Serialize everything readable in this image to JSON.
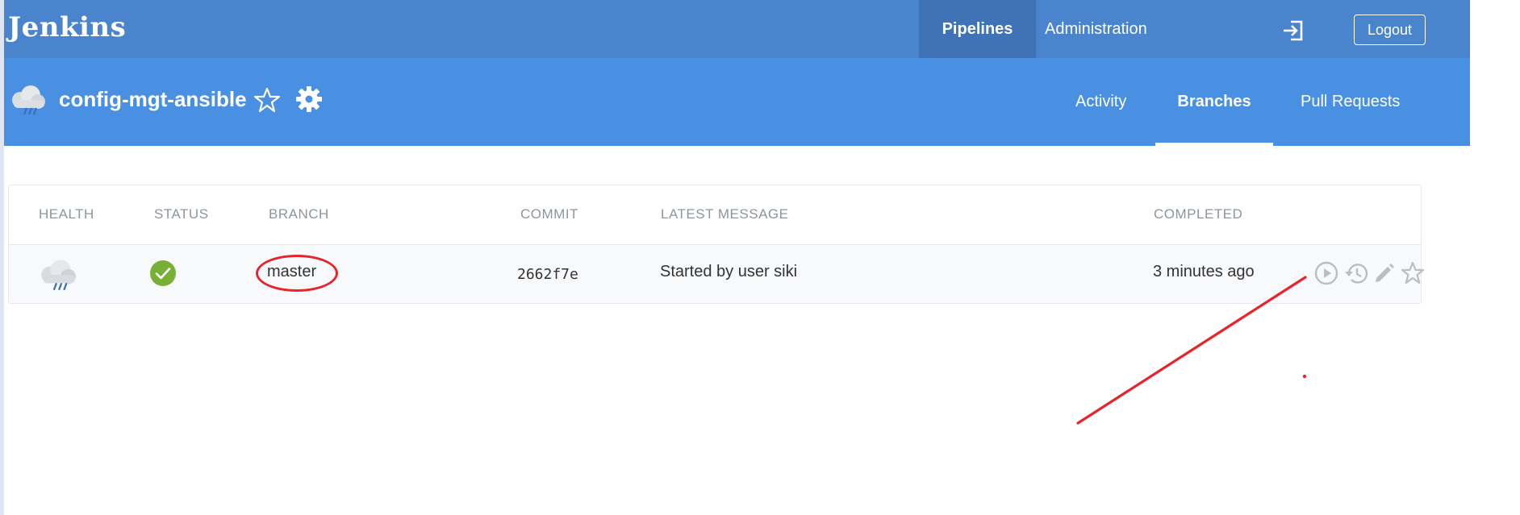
{
  "header": {
    "brand": "Jenkins",
    "nav": {
      "pipelines": "Pipelines",
      "administration": "Administration"
    },
    "logout_label": "Logout",
    "icons": {
      "exit": "exit-icon"
    },
    "colors": {
      "topbar": "#4a84cd",
      "active_nav": "#3f73b6"
    }
  },
  "pipeline": {
    "name": "config-mgt-ansible",
    "health_icon": "rain-cloud-icon",
    "icons": [
      "star-icon",
      "gear-icon"
    ],
    "colors": {
      "subbar": "#4a90e2"
    }
  },
  "tabs": [
    {
      "label": "Activity",
      "active": false
    },
    {
      "label": "Branches",
      "active": true
    },
    {
      "label": "Pull Requests",
      "active": false
    }
  ],
  "table": {
    "columns": [
      "HEALTH",
      "STATUS",
      "BRANCH",
      "COMMIT",
      "LATEST MESSAGE",
      "COMPLETED"
    ],
    "rows": [
      {
        "health": "rain-cloud-icon",
        "status": "success-check-icon",
        "branch": "master",
        "commit": "2662f7e",
        "message": "Started by user siki",
        "completed": "3 minutes ago",
        "actions": [
          "run-icon",
          "history-icon",
          "edit-icon",
          "star-icon"
        ]
      }
    ]
  },
  "annotation": {
    "color": "#e5242c"
  }
}
